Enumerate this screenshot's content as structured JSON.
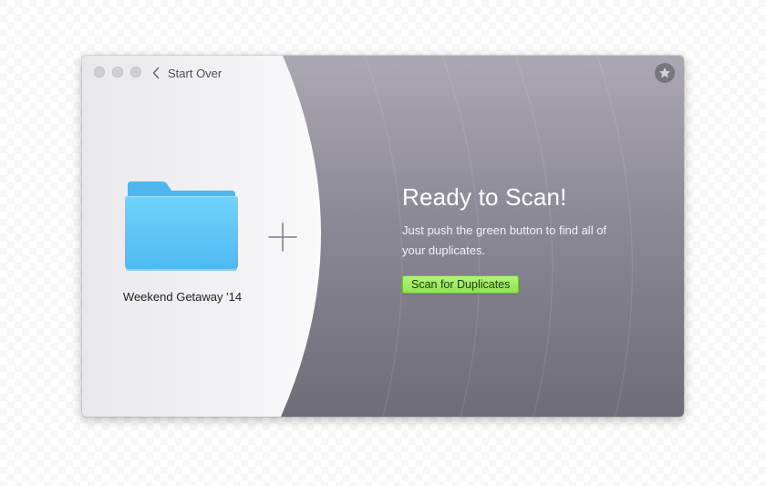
{
  "window": {
    "back_label": "Start Over"
  },
  "source": {
    "folder_name": "Weekend Getaway '14"
  },
  "main": {
    "title": "Ready to Scan!",
    "subtitle": "Just push the green button to find all of your duplicates.",
    "scan_button_label": "Scan for Duplicates"
  },
  "icons": {
    "back": "chevron-left-icon",
    "folder": "folder-icon",
    "add": "plus-icon",
    "favorite": "star-icon"
  },
  "colors": {
    "accent_green": "#9ded64",
    "folder_blue": "#5ec8f7",
    "left_panel": "#f2f2f4",
    "right_panel": "#7d7a87"
  }
}
